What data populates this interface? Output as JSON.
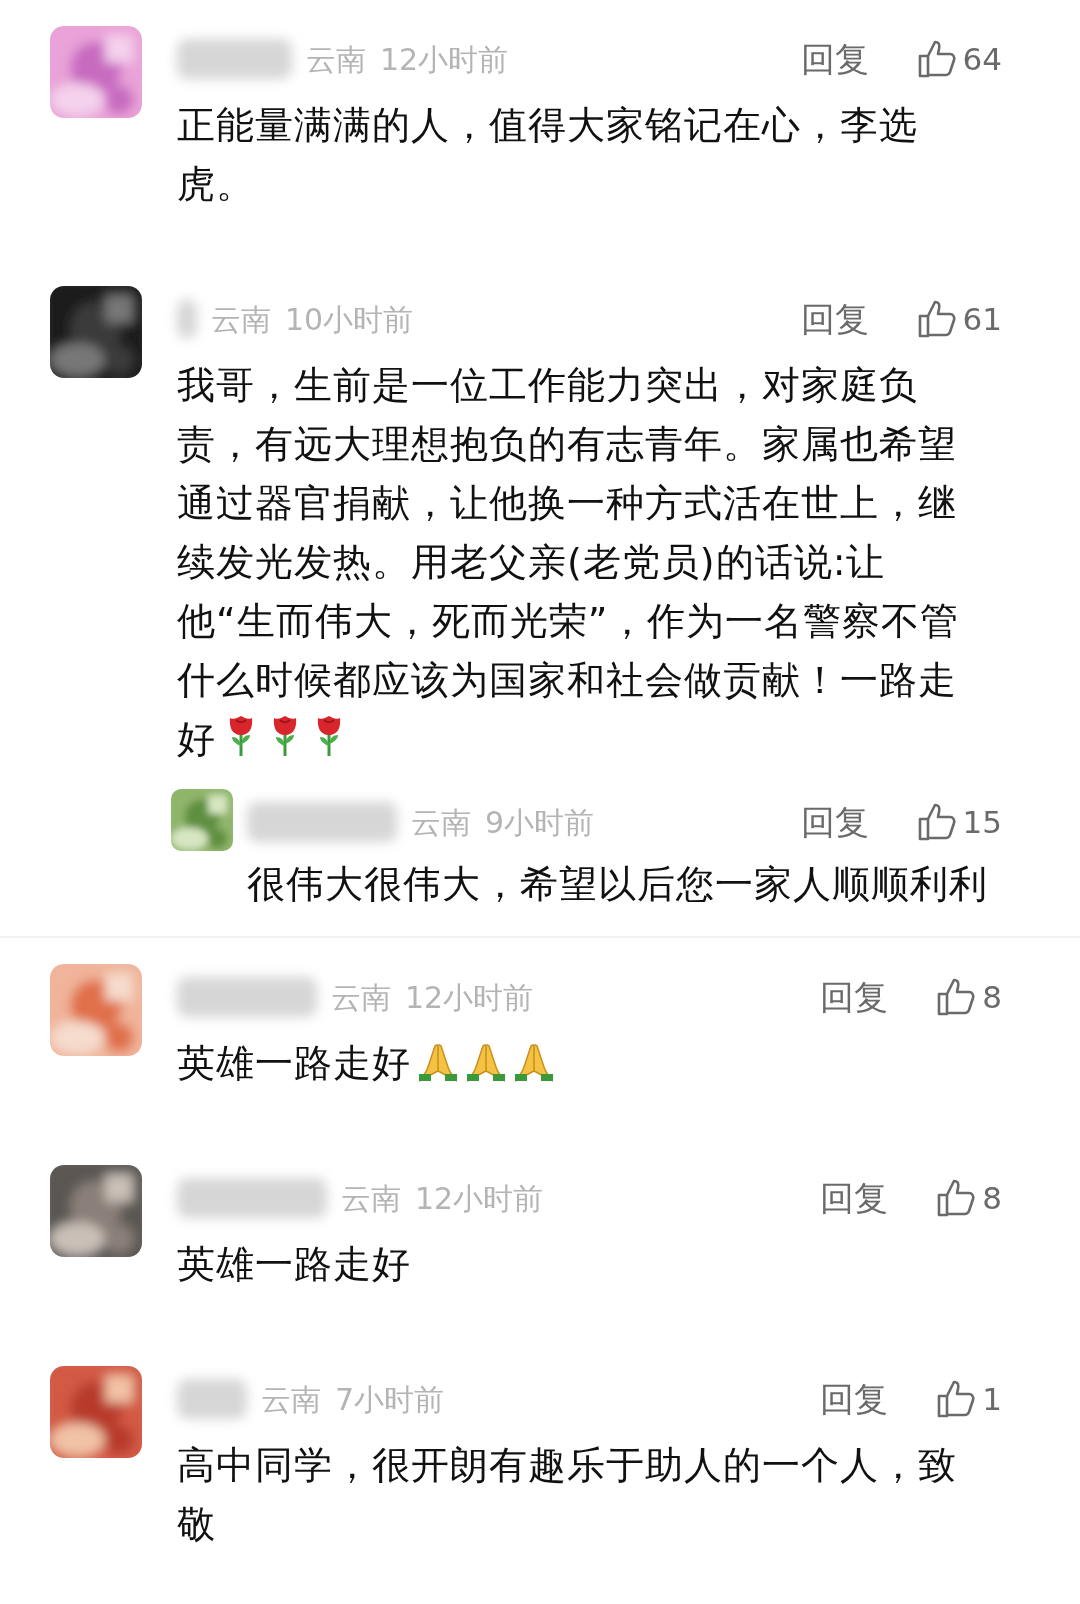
{
  "comments": [
    {
      "location": "云南",
      "time": "12小时前",
      "reply_label": "回复",
      "likes": "64",
      "text": "正能量满满的人，值得大家铭记在心，李选虎。"
    },
    {
      "location": "云南",
      "time": "10小时前",
      "reply_label": "回复",
      "likes": "61",
      "text": "我哥，生前是一位工作能力突出，对家庭负责，有远大理想抱负的有志青年。家属也希望通过器官捐献，让他换一种方式活在世上，继续发光发热。用老父亲(老党员)的话说:让他“生而伟大，死而光荣”，作为一名警察不管什么时候都应该为国家和社会做贡献！一路走好",
      "emojis": [
        {
          "kind": "rose"
        },
        {
          "kind": "rose"
        },
        {
          "kind": "rose"
        }
      ],
      "replies": [
        {
          "location": "云南",
          "time": "9小时前",
          "reply_label": "回复",
          "likes": "15",
          "text": "很伟大很伟大，希望以后您一家人顺顺利利"
        }
      ]
    },
    {
      "location": "云南",
      "time": "12小时前",
      "reply_label": "回复",
      "likes": "8",
      "text": "英雄一路走好",
      "emojis": [
        {
          "kind": "pray"
        },
        {
          "kind": "pray"
        },
        {
          "kind": "pray"
        }
      ]
    },
    {
      "location": "云南",
      "time": "12小时前",
      "reply_label": "回复",
      "likes": "8",
      "text": "英雄一路走好"
    },
    {
      "location": "云南",
      "time": "7小时前",
      "reply_label": "回复",
      "likes": "1",
      "text": "高中同学，很开朗有趣乐于助人的一个人，致敬"
    }
  ]
}
